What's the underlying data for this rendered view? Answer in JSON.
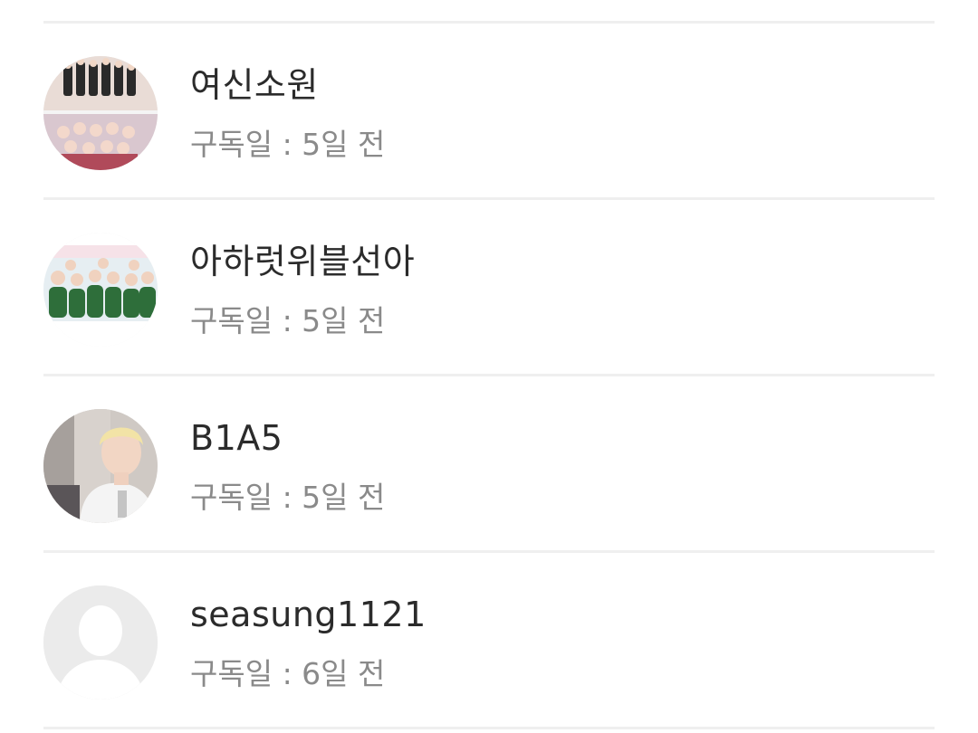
{
  "subscriptions": [
    {
      "name": "여신소원",
      "subscribed": "구독일 : 5일 전",
      "avatar_icon": "group-photo-avatar"
    },
    {
      "name": "아하럿위블선아",
      "subscribed": "구독일 : 5일 전",
      "avatar_icon": "group-photo-avatar"
    },
    {
      "name": "B1A5",
      "subscribed": "구독일 : 5일 전",
      "avatar_icon": "person-photo-avatar"
    },
    {
      "name": "seasung1121",
      "subscribed": "구독일 : 6일 전",
      "avatar_icon": "default-user-avatar"
    }
  ],
  "colors": {
    "divider": "#efefef",
    "name_text": "#2b2b2b",
    "meta_text": "#8a8a8a",
    "placeholder_avatar": "#eaeaea"
  }
}
